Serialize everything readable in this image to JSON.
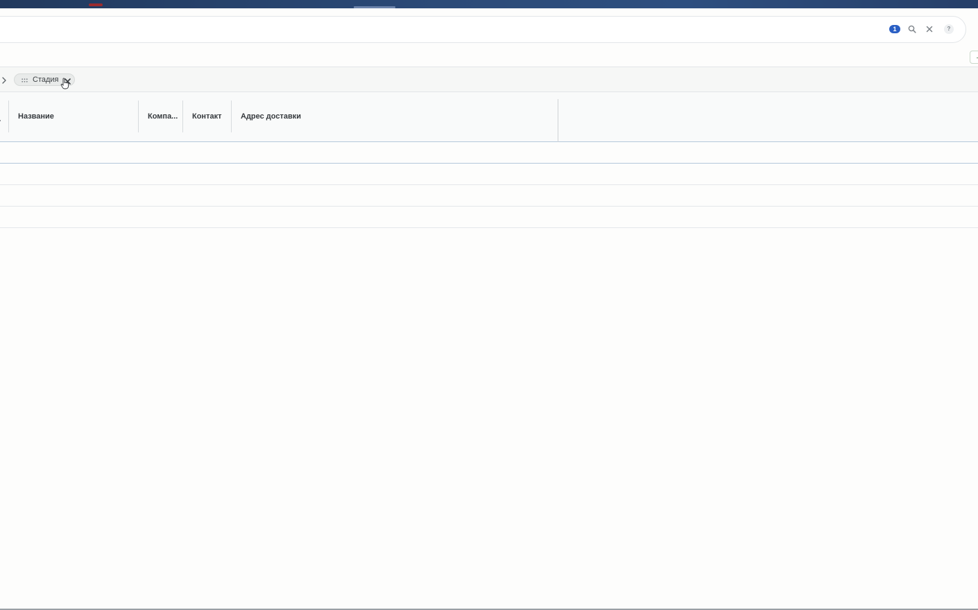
{
  "browser": {
    "accent_color": "#2b4a78"
  },
  "filter_bar": {
    "badge_count": "1",
    "icons": [
      "search-icon",
      "close-icon",
      "help-icon"
    ],
    "help_label": "?",
    "badge_color": "#2a5fc4"
  },
  "grouping": {
    "chip_label": "Стадия",
    "icons": [
      "drag-handle-icon",
      "close-icon",
      "chevron-right-icon"
    ]
  },
  "table": {
    "columns": [
      {
        "label": "Название"
      },
      {
        "label": "Компа..."
      },
      {
        "label": "Контакт"
      },
      {
        "label": "Адрес доставки"
      }
    ],
    "rows": [
      {
        "cells": []
      },
      {
        "cells": []
      },
      {
        "cells": []
      },
      {
        "cells": []
      }
    ]
  }
}
